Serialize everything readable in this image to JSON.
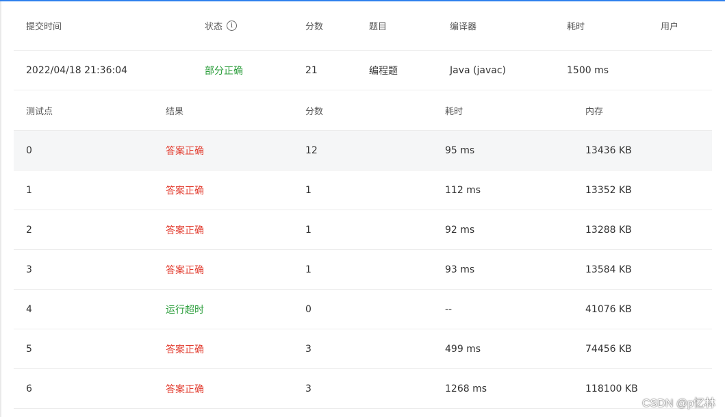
{
  "submission": {
    "headers": {
      "time": "提交时间",
      "status": "状态",
      "score": "分数",
      "problem": "题目",
      "compiler": "编译器",
      "elapsed": "耗时",
      "user": "用户"
    },
    "row": {
      "time": "2022/04/18 21:36:04",
      "status": "部分正确",
      "score": "21",
      "problem": "编程题",
      "compiler": "Java (javac)",
      "elapsed": "1500 ms",
      "user": ""
    }
  },
  "cases": {
    "headers": {
      "id": "测试点",
      "result": "结果",
      "score": "分数",
      "time": "耗时",
      "memory": "内存"
    },
    "rows": [
      {
        "id": "0",
        "result": "答案正确",
        "score": "12",
        "time": "95 ms",
        "memory": "13436 KB"
      },
      {
        "id": "1",
        "result": "答案正确",
        "score": "1",
        "time": "112 ms",
        "memory": "13352 KB"
      },
      {
        "id": "2",
        "result": "答案正确",
        "score": "1",
        "time": "92 ms",
        "memory": "13288 KB"
      },
      {
        "id": "3",
        "result": "答案正确",
        "score": "1",
        "time": "93 ms",
        "memory": "13584 KB"
      },
      {
        "id": "4",
        "result": "运行超时",
        "score": "0",
        "time": "--",
        "memory": "41076 KB"
      },
      {
        "id": "5",
        "result": "答案正确",
        "score": "3",
        "time": "499 ms",
        "memory": "74456 KB"
      },
      {
        "id": "6",
        "result": "答案正确",
        "score": "3",
        "time": "1268 ms",
        "memory": "118100 KB"
      }
    ]
  },
  "colors": {
    "accepted": "#e23b2e",
    "timeout": "#2a9d3a",
    "partial": "#2a9d3a"
  },
  "icons": {
    "status_info": "info-circle-icon"
  },
  "watermark": "CSDN @p忆林"
}
